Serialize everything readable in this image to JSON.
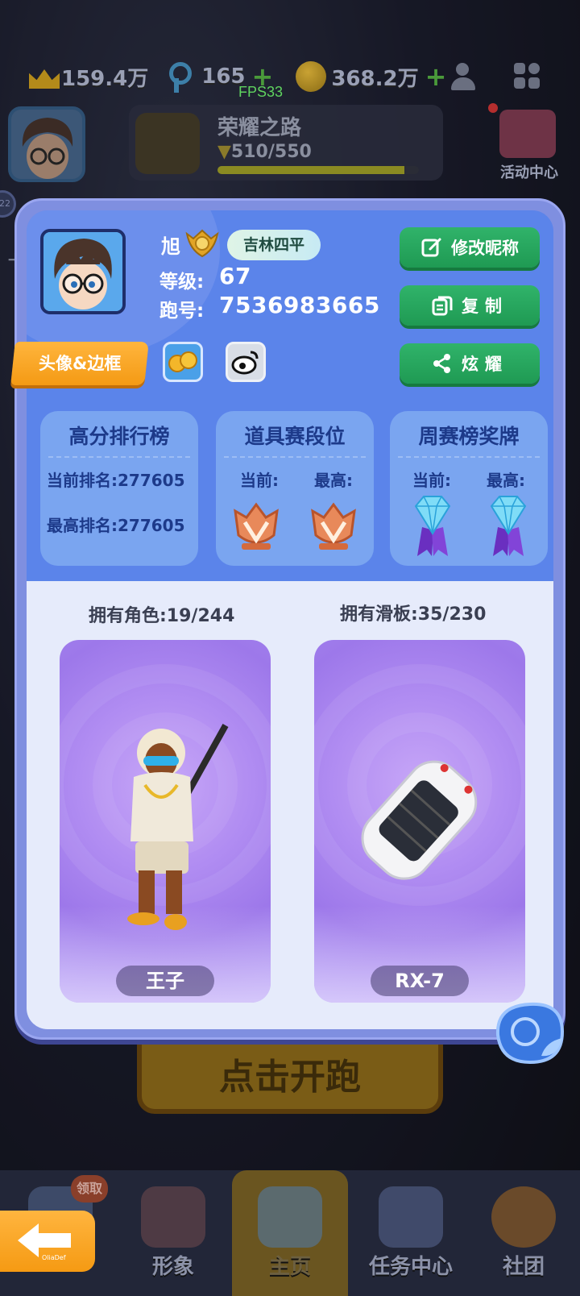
{
  "topbar": {
    "trophies": "159.4万",
    "keys": "165",
    "coins": "368.2万",
    "plus": "+",
    "icons": [
      "crown-icon",
      "key-icon",
      "coin-icon",
      "friends-icon",
      "menu-grid-icon"
    ]
  },
  "fps": "FPS33",
  "glory": {
    "title": "荣耀之路",
    "progress": "510/550",
    "fraction": 0.927
  },
  "event_center": {
    "label": "活动中心"
  },
  "side": {
    "badge": "22",
    "ten": "十"
  },
  "profile": {
    "name": "旭",
    "location": "吉林四平",
    "level_label": "等级:",
    "level": "67",
    "id_label": "跑号:",
    "id": "7536983665",
    "frame_button": "头像&边框",
    "edit_nickname": "修改昵称",
    "copy": "复制",
    "show_off": "炫耀"
  },
  "stats": {
    "high_score": {
      "title": "高分排行榜",
      "current": "当前排名:277605",
      "best": "最高排名:277605"
    },
    "item_race": {
      "title": "道具赛段位",
      "current_label": "当前:",
      "best_label": "最高:",
      "current_medal": "bronze",
      "best_medal": "bronze"
    },
    "weekly": {
      "title": "周赛榜奖牌",
      "current_label": "当前:",
      "best_label": "最高:",
      "current_medal": "diamond",
      "best_medal": "diamond"
    }
  },
  "owned": {
    "characters": "拥有角色:19/244",
    "boards": "拥有滑板:35/230",
    "character_name": "王子",
    "board_name": "RX-7"
  },
  "start": {
    "label": "点击开跑"
  },
  "nav": {
    "claim": "领取",
    "items": [
      "",
      "形象",
      "主页",
      "任务中心",
      "社团"
    ],
    "active": "主页"
  },
  "back": {
    "caption": "OliaDef"
  },
  "colors": {
    "modal": "#5b84ea",
    "green_button": "#1f9a53",
    "orange": "#f59a13",
    "card_purple": "#b18df2"
  }
}
